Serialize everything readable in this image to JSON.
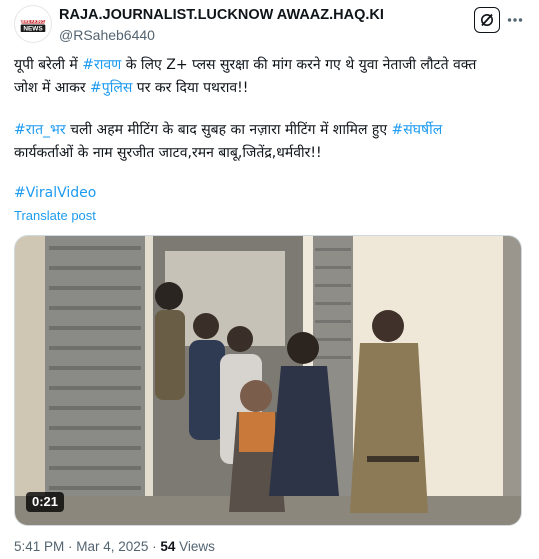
{
  "author": {
    "display_name": "RAJA.JOURNALIST.LUCKNOW AWAAZ.HAQ.KI",
    "handle": "@RSaheb6440",
    "avatar": {
      "line1": "BREAKING",
      "line2": "NEWS",
      "color": "#c4161c"
    }
  },
  "header_icons": {
    "grok": "grok-icon",
    "more": "more-icon"
  },
  "post": {
    "para1_line1_a": "यूपी बरेली में ",
    "para1_line1_tag": "#रावण",
    "para1_line1_b": " के लिए Z+ प्लस सुरक्षा की मांग करने गए थे युवा नेताजी लौटते वक्त",
    "para1_line2_a": "जोश में आकर ",
    "para1_line2_tag": "#पुलिस",
    "para1_line2_b": " पर कर दिया पथराव!!",
    "para2_tag1": "#रात_भर",
    "para2_line1_b": " चली अहम मीटिंग के बाद सुबह का नज़ारा मीटिंग में शामिल हुए ",
    "para2_tag2": "#संघर्षील",
    "para2_line2": "कार्यकर्ताओं के नाम सुरजीत जाटव,रमन बाबू,जितेंद्र,धर्मवीर!!",
    "hashtag": "#ViralVideo",
    "translate": "Translate post"
  },
  "media": {
    "type": "video",
    "duration": "0:21"
  },
  "meta": {
    "time": "5:41 PM",
    "sep1": " · ",
    "date": "Mar 4, 2025",
    "sep2": " · ",
    "views": "54",
    "views_label": " Views"
  },
  "colors": {
    "link": "#1d9bf0",
    "text": "#0f1419",
    "secondary": "#536471"
  }
}
